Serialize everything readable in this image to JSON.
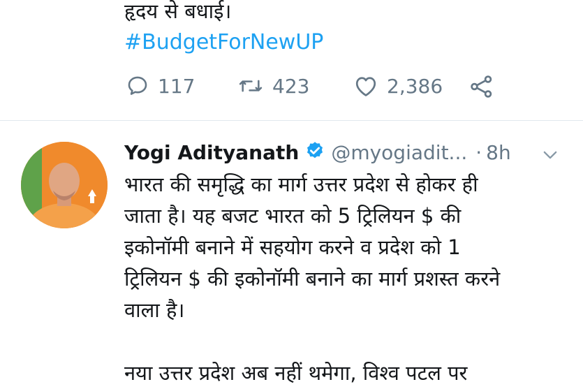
{
  "previous_tweet": {
    "text_tail": "हृदय से बधाई।",
    "hashtag": "#BudgetForNewUP",
    "actions": {
      "reply_count": "117",
      "retweet_count": "423",
      "like_count": "2,386"
    }
  },
  "tweet": {
    "author_name": "Yogi Adityanath",
    "handle": "@myogiadit...",
    "separator": "·",
    "time": "8h",
    "body_lines": [
      "भारत की समृद्धि का मार्ग उत्तर प्रदेश से होकर ही",
      "जाता है। यह बजट भारत को 5 ट्रिलियन $ की",
      "इकोनॉमी बनाने में सहयोग करने व प्रदेश को 1",
      "ट्रिलियन $ की इकोनॉमी बनाने का मार्ग प्रशस्त करने",
      "वाला है।"
    ],
    "body_lines_2": [
      "नया उत्तर प्रदेश अब नहीं थमेगा, विश्व पटल पर"
    ]
  },
  "colors": {
    "link": "#1da1f2",
    "muted": "#657786",
    "divider": "#e1e8ed",
    "avatar_bg": "#f08a2c"
  },
  "icons": {
    "reply": "reply-icon",
    "retweet": "retweet-icon",
    "like": "heart-icon",
    "share": "share-icon",
    "verified": "verified-badge-icon",
    "more": "chevron-down-icon"
  }
}
